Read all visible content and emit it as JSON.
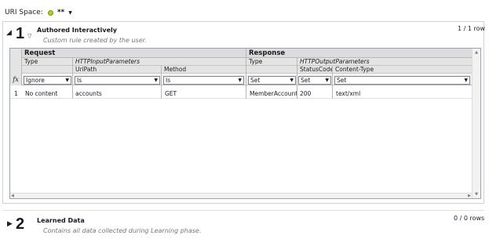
{
  "uri_space": {
    "label": "URI Space:",
    "value": "**",
    "status_color": "#b5cc1e"
  },
  "section1": {
    "number": "1",
    "title": "Authored Interactively",
    "description": "Custom rule created by the user.",
    "row_count": "1 / 1 row",
    "grid": {
      "groups": {
        "request": "Request",
        "response": "Response"
      },
      "subheaders": {
        "req_type": "Type",
        "http_input": "HTTPInputParameters",
        "uripath": "UriPath",
        "method": "Method",
        "resp_type": "Type",
        "http_output": "HTTPOutputParameters",
        "statuscode": "StatusCode",
        "content_type": "Content-Type"
      },
      "filter_row": {
        "fx": "fx",
        "req_type": "Ignore",
        "uripath": "Is",
        "method": "Is",
        "resp_type": "Set",
        "statuscode": "Set",
        "content_type": "Set"
      },
      "rows": [
        {
          "index": "1",
          "req_type": "No content",
          "uripath": "accounts",
          "method": "GET",
          "resp_type": "MemberAccount",
          "statuscode": "200",
          "content_type": "text/xml"
        }
      ]
    }
  },
  "section2": {
    "number": "2",
    "title": "Learned Data",
    "description": "Contains all data collected during Learning phase.",
    "row_count": "0 / 0 rows"
  },
  "icons": {
    "expanded": "expanded-arrow-icon",
    "collapsed": "collapsed-arrow-icon",
    "chevron": "chevron-down-icon",
    "dropdown": "dropdown-caret-icon"
  }
}
